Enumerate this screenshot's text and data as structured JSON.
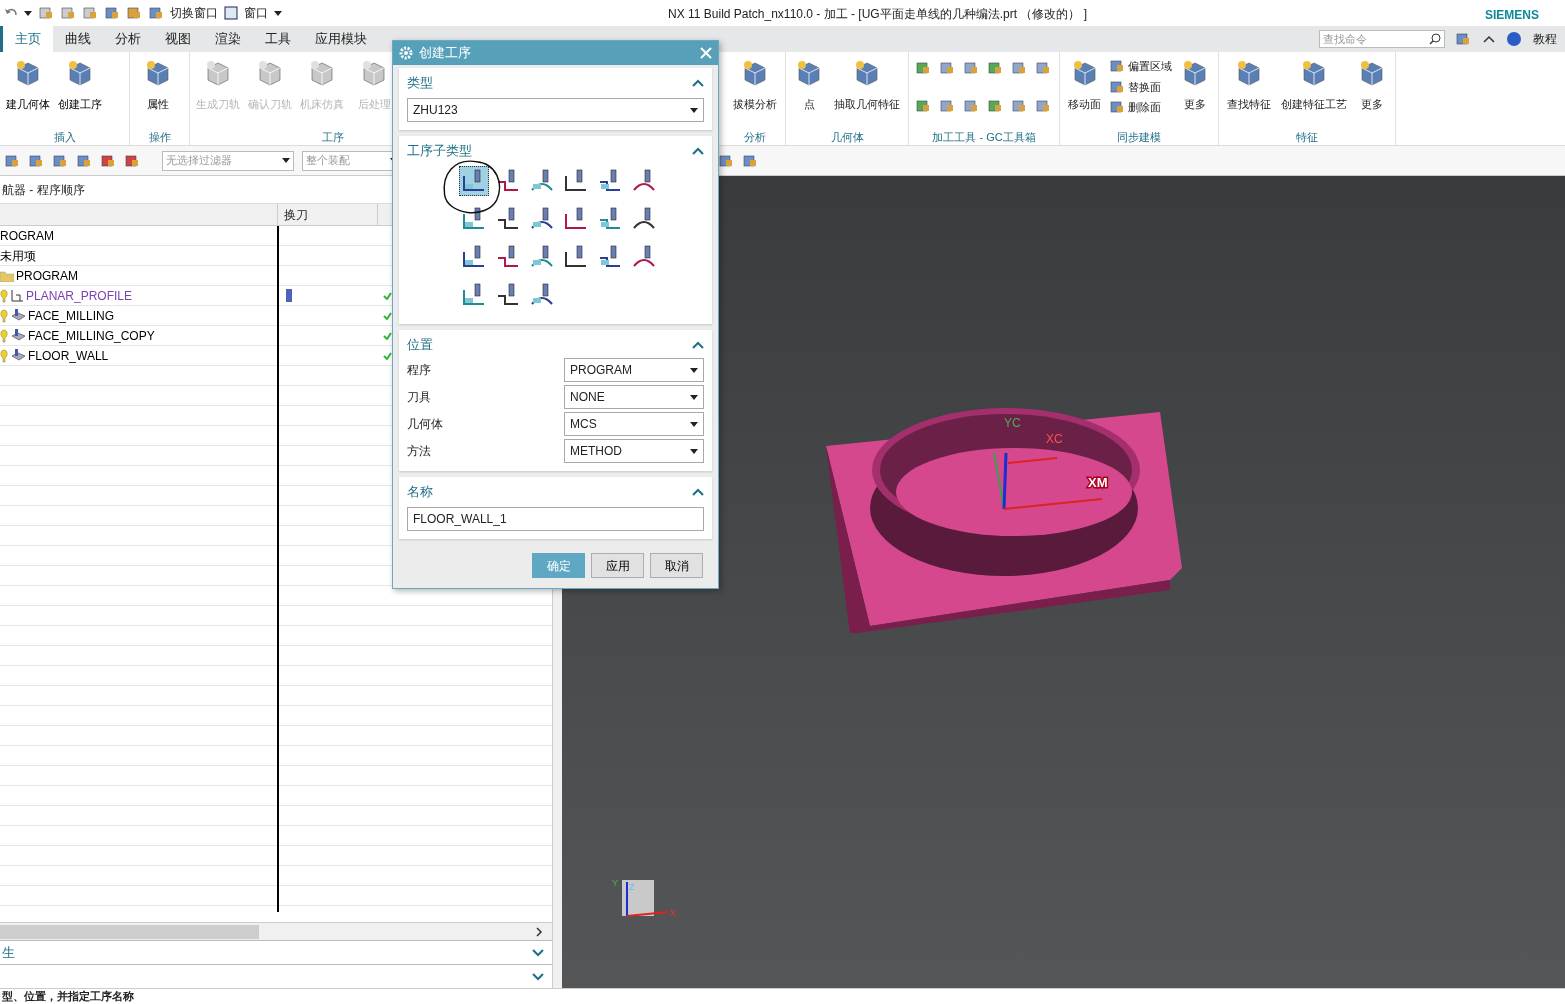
{
  "title_bar": {
    "quick_access": [
      "切换窗口",
      "窗口"
    ],
    "title": "NX 11  Build Patch_nx110.0 - 加工 - [UG平面走单线的几种编法.prt （修改的） ]",
    "brand": "SIEMENS"
  },
  "tabs": [
    {
      "label": "主页",
      "selected": true
    },
    {
      "label": "曲线",
      "selected": false
    },
    {
      "label": "分析",
      "selected": false
    },
    {
      "label": "视图",
      "selected": false
    },
    {
      "label": "渲染",
      "selected": false
    },
    {
      "label": "工具",
      "selected": false
    },
    {
      "label": "应用模块",
      "selected": false
    }
  ],
  "search": {
    "placeholder": "查找命令"
  },
  "help_link": "教程",
  "ribbon_left": [
    {
      "label": "插入",
      "buttons": [
        {
          "label": "建几何体",
          "disabled": false
        },
        {
          "label": "创建工序",
          "disabled": false
        }
      ]
    },
    {
      "label": "操作",
      "buttons": [
        {
          "label": "属性",
          "disabled": false
        }
      ]
    },
    {
      "label": "工序",
      "buttons": [
        {
          "label": "生成刀轨",
          "disabled": true
        },
        {
          "label": "确认刀轨",
          "disabled": true
        },
        {
          "label": "机床仿真",
          "disabled": true
        },
        {
          "label": "后处理",
          "disabled": true
        }
      ]
    }
  ],
  "ribbon_right": [
    {
      "label": "分析",
      "buttons": [
        {
          "label": "拔模分析",
          "kind": "large"
        }
      ]
    },
    {
      "label": "几何体",
      "buttons": [
        {
          "label": "点",
          "kind": "large"
        },
        {
          "label": "抽取几何特征",
          "kind": "large"
        }
      ]
    },
    {
      "label": "加工工具 - GC工具箱"
    },
    {
      "label": "同步建模",
      "buttons": [
        {
          "label": "移动面",
          "kind": "large"
        },
        {
          "label": "偏置区域",
          "kind": "small"
        },
        {
          "label": "替换面",
          "kind": "small"
        },
        {
          "label": "删除面",
          "kind": "small"
        },
        {
          "label": "更多",
          "kind": "large"
        }
      ]
    },
    {
      "label": "特征",
      "buttons": [
        {
          "label": "查找特征",
          "kind": "large"
        },
        {
          "label": "创建特征工艺",
          "kind": "large"
        },
        {
          "label": "更多",
          "kind": "large"
        }
      ]
    }
  ],
  "filters": [
    {
      "value": "无选择过滤器"
    },
    {
      "value": "整个装配"
    }
  ],
  "navigator": {
    "title": "航器 - 程序顺序",
    "columns": [
      "换刀"
    ],
    "rows": [
      {
        "name": "ROGRAM",
        "kind": "root",
        "current": false,
        "tool_change": false
      },
      {
        "name": "未用项",
        "kind": "root",
        "current": false,
        "tool_change": false
      },
      {
        "name": "PROGRAM",
        "kind": "folder",
        "current": false,
        "tool_change": false
      },
      {
        "name": "PLANAR_PROFILE",
        "kind": "profile",
        "current": true,
        "tool_change": true
      },
      {
        "name": "FACE_MILLING",
        "kind": "operation",
        "current": false,
        "tool_change": false
      },
      {
        "name": "FACE_MILLING_COPY",
        "kind": "operation",
        "current": false,
        "tool_change": false
      },
      {
        "name": "FLOOR_WALL",
        "kind": "operation",
        "current": false,
        "tool_change": false
      }
    ],
    "panels": [
      {
        "title": "生",
        "expanded": false
      },
      {
        "expanded": false
      }
    ]
  },
  "dialog": {
    "title": "创建工序",
    "type_section": {
      "title": "类型",
      "expanded": true,
      "value": "ZHU123"
    },
    "subtype_section": {
      "title": "工序子类型",
      "expanded": true,
      "subtypes": [
        {
          "selected": true
        },
        {
          "selected": false
        },
        {
          "selected": false
        },
        {
          "selected": false
        },
        {
          "selected": false
        },
        {
          "selected": false
        },
        {
          "selected": false
        },
        {
          "selected": false
        },
        {
          "selected": false
        },
        {
          "selected": false
        },
        {
          "selected": false
        },
        {
          "selected": false
        },
        {
          "selected": false
        },
        {
          "selected": false
        },
        {
          "selected": false
        },
        {
          "selected": false
        },
        {
          "selected": false
        },
        {
          "selected": false
        },
        {
          "selected": false
        },
        {
          "selected": false
        },
        {
          "selected": false
        }
      ]
    },
    "location_section": {
      "title": "位置",
      "expanded": true,
      "fields": [
        {
          "label": "程序",
          "value": "PROGRAM"
        },
        {
          "label": "刀具",
          "value": "NONE"
        },
        {
          "label": "几何体",
          "value": "MCS"
        },
        {
          "label": "方法",
          "value": "METHOD"
        }
      ]
    },
    "name_section": {
      "title": "名称",
      "expanded": true,
      "value": "FLOOR_WALL_1"
    },
    "buttons": [
      {
        "label": "确定",
        "kind": "primary"
      },
      {
        "label": "应用",
        "kind": "normal"
      },
      {
        "label": "取消",
        "kind": "normal"
      }
    ]
  },
  "viewport": {
    "axis_labels": [
      "YC",
      "XC",
      "XM"
    ],
    "triad_labels": [
      "Y",
      "Z",
      "X"
    ]
  },
  "status_bar": "型、位置，并指定工序名称"
}
